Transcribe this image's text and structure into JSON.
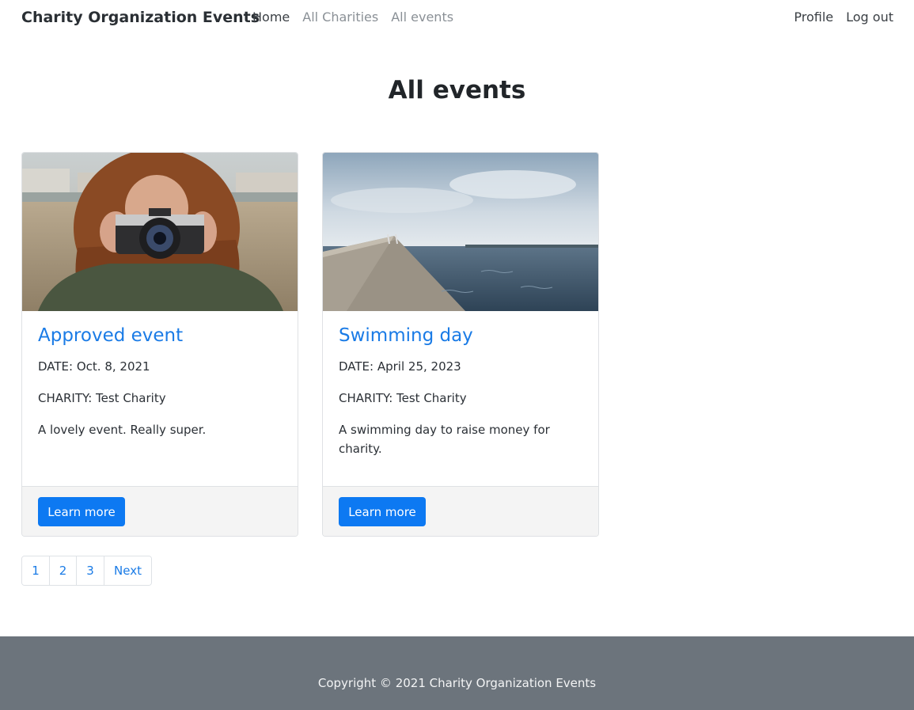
{
  "navbar": {
    "brand": "Charity Organization Events",
    "links_left": [
      "Home",
      "All Charities",
      "All events"
    ],
    "links_right": [
      "Profile",
      "Log out"
    ]
  },
  "page": {
    "title": "All events"
  },
  "events": [
    {
      "title": "Approved event",
      "date": "DATE: Oct. 8, 2021",
      "charity": "CHARITY: Test Charity",
      "description": "A lovely event. Really super.",
      "button": "Learn more",
      "image": "woman-with-camera-photo"
    },
    {
      "title": "Swimming day",
      "date": "DATE: April 25, 2023",
      "charity": "CHARITY: Test Charity",
      "description": "A swimming day to raise money for charity.",
      "button": "Learn more",
      "image": "pier-and-water-photo"
    }
  ],
  "pagination": {
    "pages": [
      "1",
      "2",
      "3"
    ],
    "next": "Next"
  },
  "footer": {
    "copyright": "Copyright © 2021 Charity Organization Events"
  },
  "colors": {
    "link": "#1a7be6",
    "button": "#0d79f2",
    "footer_bg": "#6c747c"
  }
}
